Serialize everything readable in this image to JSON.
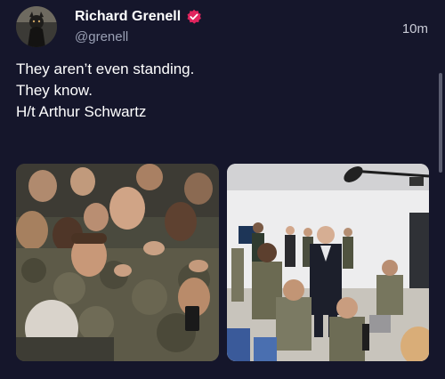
{
  "tweet": {
    "display_name": "Richard Grenell",
    "handle": "@grenell",
    "timestamp": "10m",
    "text_lines": [
      "They aren’t even standing.",
      "They know.",
      "",
      "H/t Arthur Schwartz"
    ],
    "verified": true
  },
  "colors": {
    "background": "#15162b",
    "verified_badge": "#e0245e",
    "handle_text": "#9aa0b4"
  },
  "icons": {
    "verified": "verified-badge-icon",
    "avatar": "avatar"
  },
  "media": [
    {
      "description_name": "media-photo-soldiers-crowd"
    },
    {
      "description_name": "media-photo-room-gathering"
    }
  ]
}
